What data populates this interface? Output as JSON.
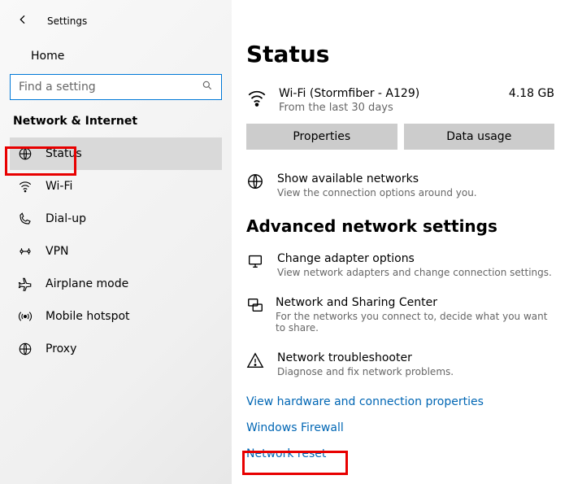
{
  "header": {
    "app_title": "Settings",
    "home_label": "Home"
  },
  "search": {
    "placeholder": "Find a setting"
  },
  "category": {
    "title": "Network & Internet"
  },
  "nav": {
    "items": [
      {
        "label": "Status"
      },
      {
        "label": "Wi-Fi"
      },
      {
        "label": "Dial-up"
      },
      {
        "label": "VPN"
      },
      {
        "label": "Airplane mode"
      },
      {
        "label": "Mobile hotspot"
      },
      {
        "label": "Proxy"
      }
    ]
  },
  "page": {
    "title": "Status"
  },
  "wifi": {
    "name": "Wi-Fi (Stormfiber - A129)",
    "subtitle": "From the last 30 days",
    "usage": "4.18 GB"
  },
  "buttons": {
    "properties": "Properties",
    "data_usage": "Data usage"
  },
  "available": {
    "title": "Show available networks",
    "desc": "View the connection options around you."
  },
  "advanced_title": "Advanced network settings",
  "adapter": {
    "title": "Change adapter options",
    "desc": "View network adapters and change connection settings."
  },
  "sharing": {
    "title": "Network and Sharing Center",
    "desc": "For the networks you connect to, decide what you want to share."
  },
  "trouble": {
    "title": "Network troubleshooter",
    "desc": "Diagnose and fix network problems."
  },
  "links": {
    "hw": "View hardware and connection properties",
    "firewall": "Windows Firewall",
    "reset": "Network reset"
  }
}
